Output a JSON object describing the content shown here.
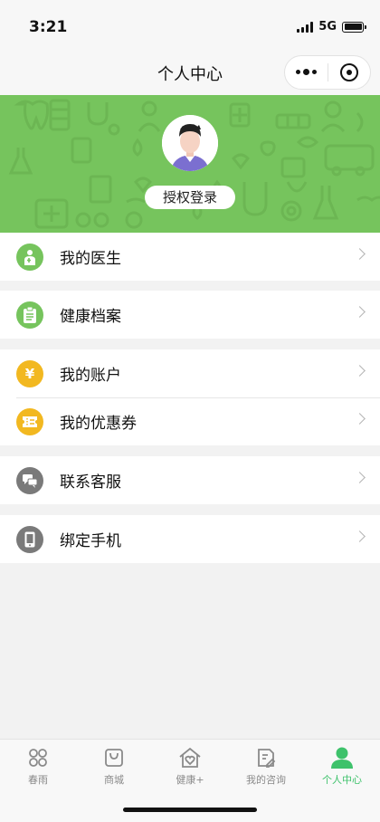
{
  "status": {
    "time": "3:21",
    "network": "5G"
  },
  "nav": {
    "title": "个人中心"
  },
  "profile": {
    "login_label": "授权登录"
  },
  "menu": {
    "doctor": "我的医生",
    "health": "健康档案",
    "account": "我的账户",
    "coupons": "我的优惠券",
    "service": "联系客服",
    "phone": "绑定手机"
  },
  "tabs": {
    "chunyu": "春雨",
    "mall": "商城",
    "health_plus": "健康+",
    "consult": "我的咨询",
    "me": "个人中心"
  },
  "colors": {
    "banner": "#76c45d",
    "accent_green": "#3ec26b",
    "icon_yellow": "#f2b820",
    "icon_gray": "#7a7a7a"
  }
}
